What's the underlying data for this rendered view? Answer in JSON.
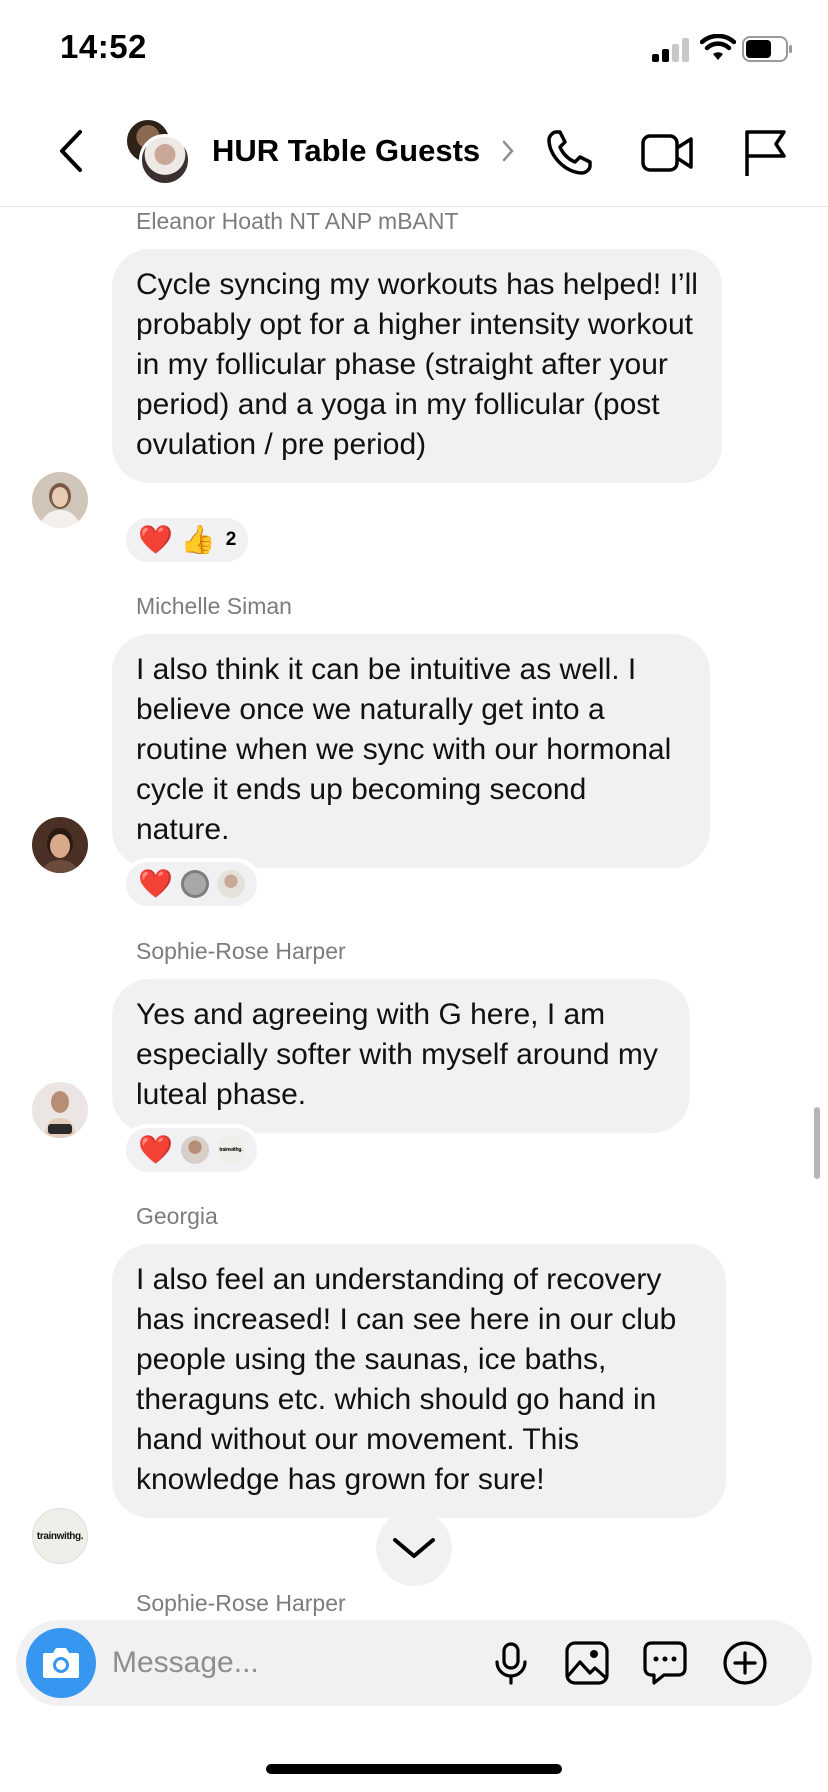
{
  "status_bar": {
    "time": "14:52"
  },
  "header": {
    "title": "HUR Table Guests"
  },
  "messages": [
    {
      "sender": "Eleanor Hoath NT ANP mBANT",
      "text": "Cycle syncing my workouts has helped! I’ll probably opt for a higher intensity workout in my follicular phase (straight after your period) and a yoga in my follicular (post ovulation / pre period)",
      "reactions": {
        "emojis": [
          "❤️",
          "👍"
        ],
        "count": "2"
      }
    },
    {
      "sender": "Michelle Siman",
      "text": "I also think it can be intuitive as well. I believe once we naturally get into a routine when we sync with our hormonal cycle it ends up becoming second nature.",
      "reactions": {
        "emojis": [
          "❤️"
        ]
      }
    },
    {
      "sender": "Sophie-Rose Harper",
      "text": "Yes and agreeing with G here, I am especially softer with myself around my luteal phase.",
      "reactions": {
        "emojis": [
          "❤️"
        ],
        "mini_avatar_text": "trainwithg."
      }
    },
    {
      "sender": "Georgia",
      "text": "I also feel an understanding of recovery has increased! I can see here in our club people using the saunas, ice baths, theraguns etc. which should go hand in hand without our movement. This knowledge has grown for sure!",
      "avatar_text": "trainwithg."
    },
    {
      "sender": "Sophie-Rose Harper"
    }
  ],
  "composer": {
    "placeholder": "Message..."
  },
  "icons": {
    "back": "chevron-left-icon",
    "call": "phone-icon",
    "video": "video-camera-icon",
    "report": "flag-icon",
    "camera": "camera-icon",
    "mic": "microphone-icon",
    "gallery": "image-icon",
    "sticker": "chat-bubble-icon",
    "more": "plus-circle-icon"
  },
  "colors": {
    "accent": "#3797f0",
    "bubble": "#f1f1f3",
    "heart": "#ed1c24"
  }
}
